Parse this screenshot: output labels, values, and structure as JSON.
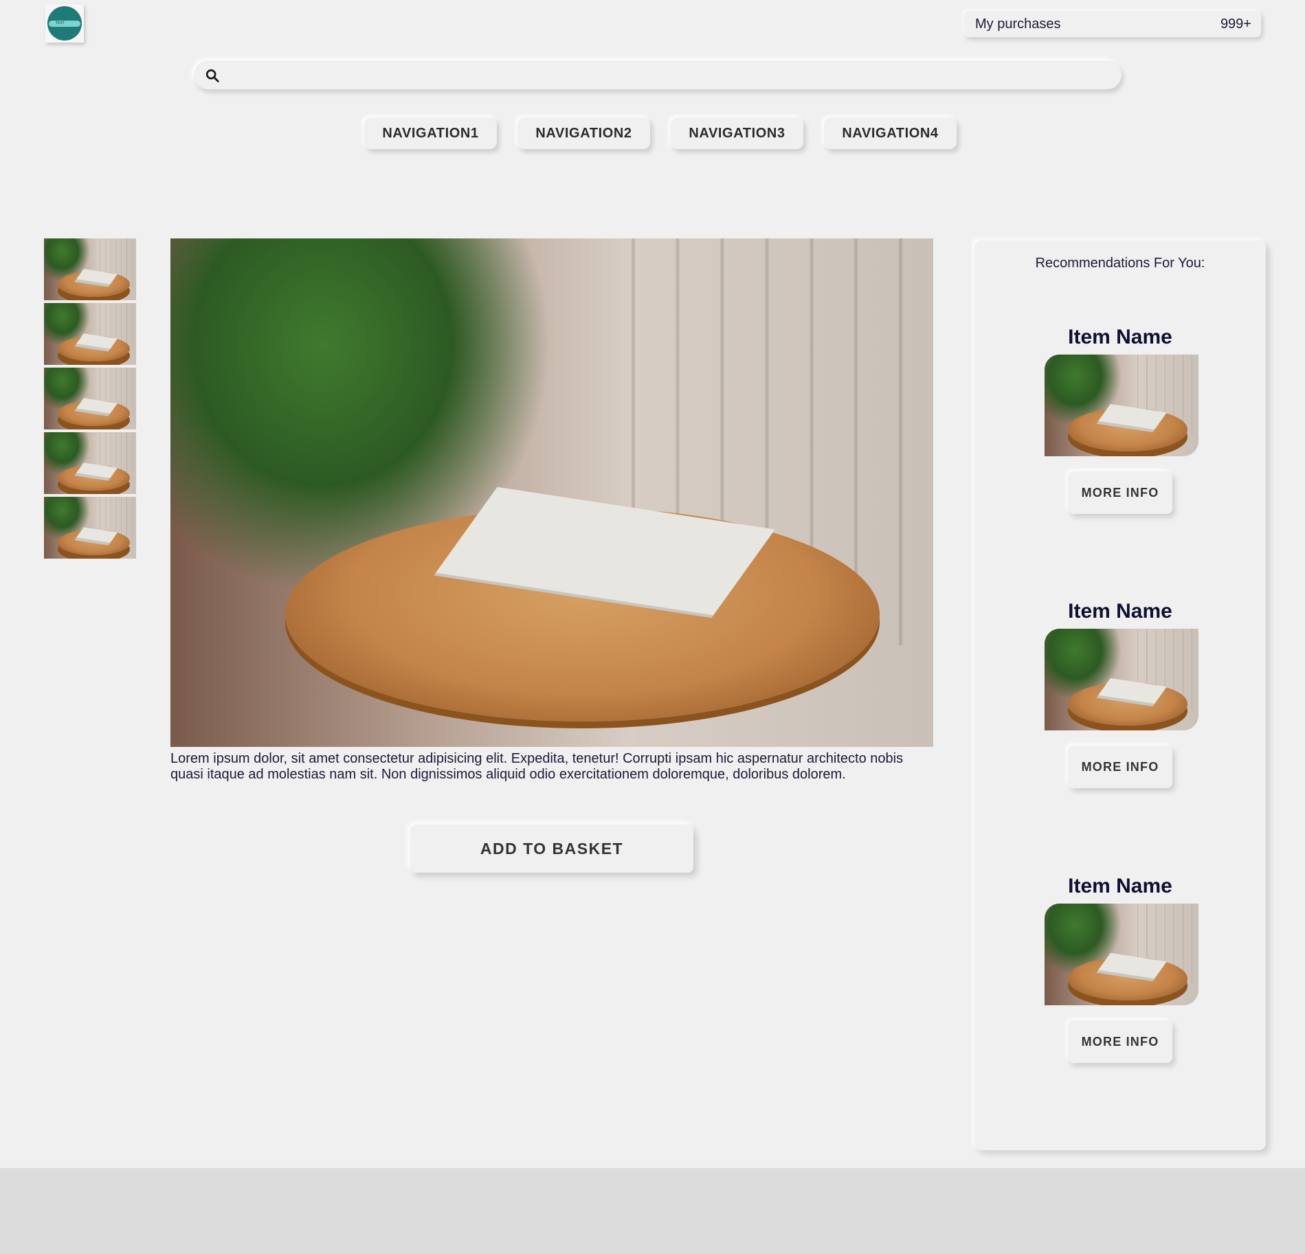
{
  "header": {
    "logo": {
      "icon": "logo-badge-icon",
      "text": "TEXT"
    },
    "purchases": {
      "label": "My purchases",
      "count": "999+"
    }
  },
  "search": {
    "placeholder": "",
    "value": "",
    "icon": "search-icon"
  },
  "navigation": [
    {
      "label": "NAVIGATION1"
    },
    {
      "label": "NAVIGATION2"
    },
    {
      "label": "NAVIGATION3"
    },
    {
      "label": "NAVIGATION4"
    }
  ],
  "product": {
    "thumbnails": 5,
    "description": "Lorem ipsum dolor, sit amet consectetur adipisicing elit. Expedita, tenetur! Corrupti ipsam hic aspernatur architecto nobis quasi itaque ad molestias nam sit. Non dignissimos aliquid odio exercitationem doloremque, doloribus dolorem.",
    "add_to_basket": "ADD TO BASKET"
  },
  "recommendations": {
    "title": "Recommendations For You:",
    "items": [
      {
        "name": "Item Name",
        "button": "MORE INFO"
      },
      {
        "name": "Item Name",
        "button": "MORE INFO"
      },
      {
        "name": "Item Name",
        "button": "MORE INFO"
      }
    ]
  },
  "colors": {
    "background": "#f0f0f0",
    "footer": "#dcdcdc",
    "logo": "#1f7a78",
    "text": "#151533"
  }
}
